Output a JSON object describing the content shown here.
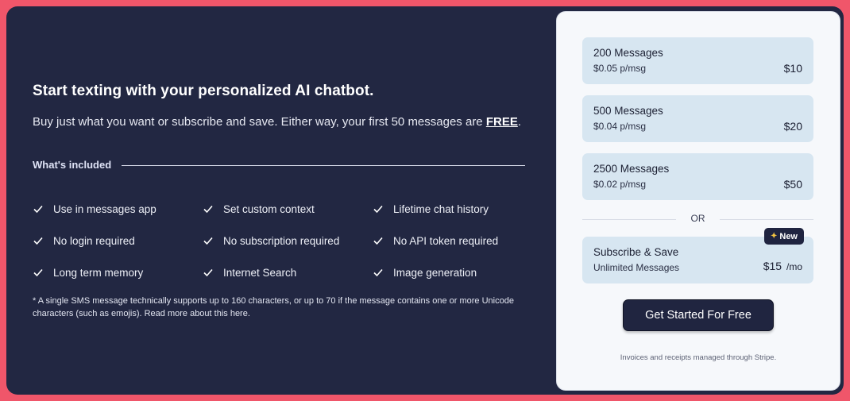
{
  "hero": {
    "headline": "Start texting with your personalized AI chatbot.",
    "subline_prefix": "Buy just what you want or subscribe and save. Either way, your first 50 messages are ",
    "subline_emphasis": "FREE",
    "subline_suffix": "."
  },
  "included": {
    "label": "What's included",
    "features": [
      "Use in messages app",
      "Set custom context",
      "Lifetime chat history",
      "No login required",
      "No subscription required",
      "No API token required",
      "Long term memory",
      "Internet Search",
      "Image generation"
    ]
  },
  "footnote": "* A single SMS message technically supports up to 160 characters, or up to 70 if the message contains one or more Unicode characters (such as emojis). Read more about this here.",
  "plans": [
    {
      "title": "200 Messages",
      "rate": "$0.05 p/msg",
      "price": "$10"
    },
    {
      "title": "500 Messages",
      "rate": "$0.04 p/msg",
      "price": "$20"
    },
    {
      "title": "2500 Messages",
      "rate": "$0.02 p/msg",
      "price": "$50"
    }
  ],
  "divider_label": "OR",
  "subscription": {
    "badge": "New",
    "title": "Subscribe & Save",
    "rate": "Unlimited Messages",
    "price": "$15",
    "unit": "/mo"
  },
  "cta_label": "Get Started For Free",
  "stripe_note": "Invoices and receipts managed through Stripe.",
  "icons": {
    "feature": "check-icon",
    "badge": "sparkle-icon"
  },
  "colors": {
    "background": "#f0566a",
    "card": "#222742",
    "plan": "#d7e6f1",
    "button": "#202540"
  }
}
